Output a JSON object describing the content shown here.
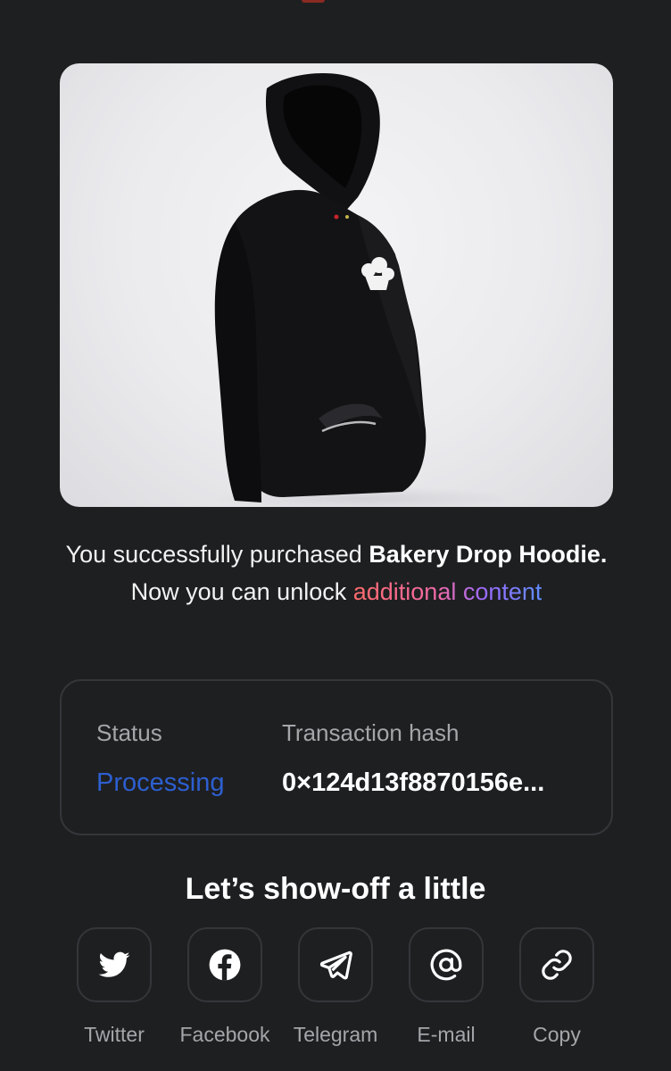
{
  "product": {
    "image_alt": "Bakery Drop Hoodie"
  },
  "message": {
    "prefix": "You successfully purchased ",
    "product_name": "Bakery Drop Hoodie.",
    "middle": " Now you can unlock ",
    "link_text": "additional content"
  },
  "transaction": {
    "status_label": "Status",
    "status_value": "Processing",
    "hash_label": "Transaction hash",
    "hash_value": "0×124d13f8870156e..."
  },
  "share": {
    "title": "Let’s show-off a little",
    "items": [
      {
        "label": "Twitter",
        "icon": "twitter-icon"
      },
      {
        "label": "Facebook",
        "icon": "facebook-icon"
      },
      {
        "label": "Telegram",
        "icon": "telegram-icon"
      },
      {
        "label": "E-mail",
        "icon": "at-sign-icon"
      },
      {
        "label": "Copy",
        "icon": "link-icon"
      }
    ]
  },
  "colors": {
    "background": "#1e1f21",
    "card_border": "#34363a",
    "status_processing": "#2d5fd0",
    "muted_text": "#a4a6aa"
  }
}
